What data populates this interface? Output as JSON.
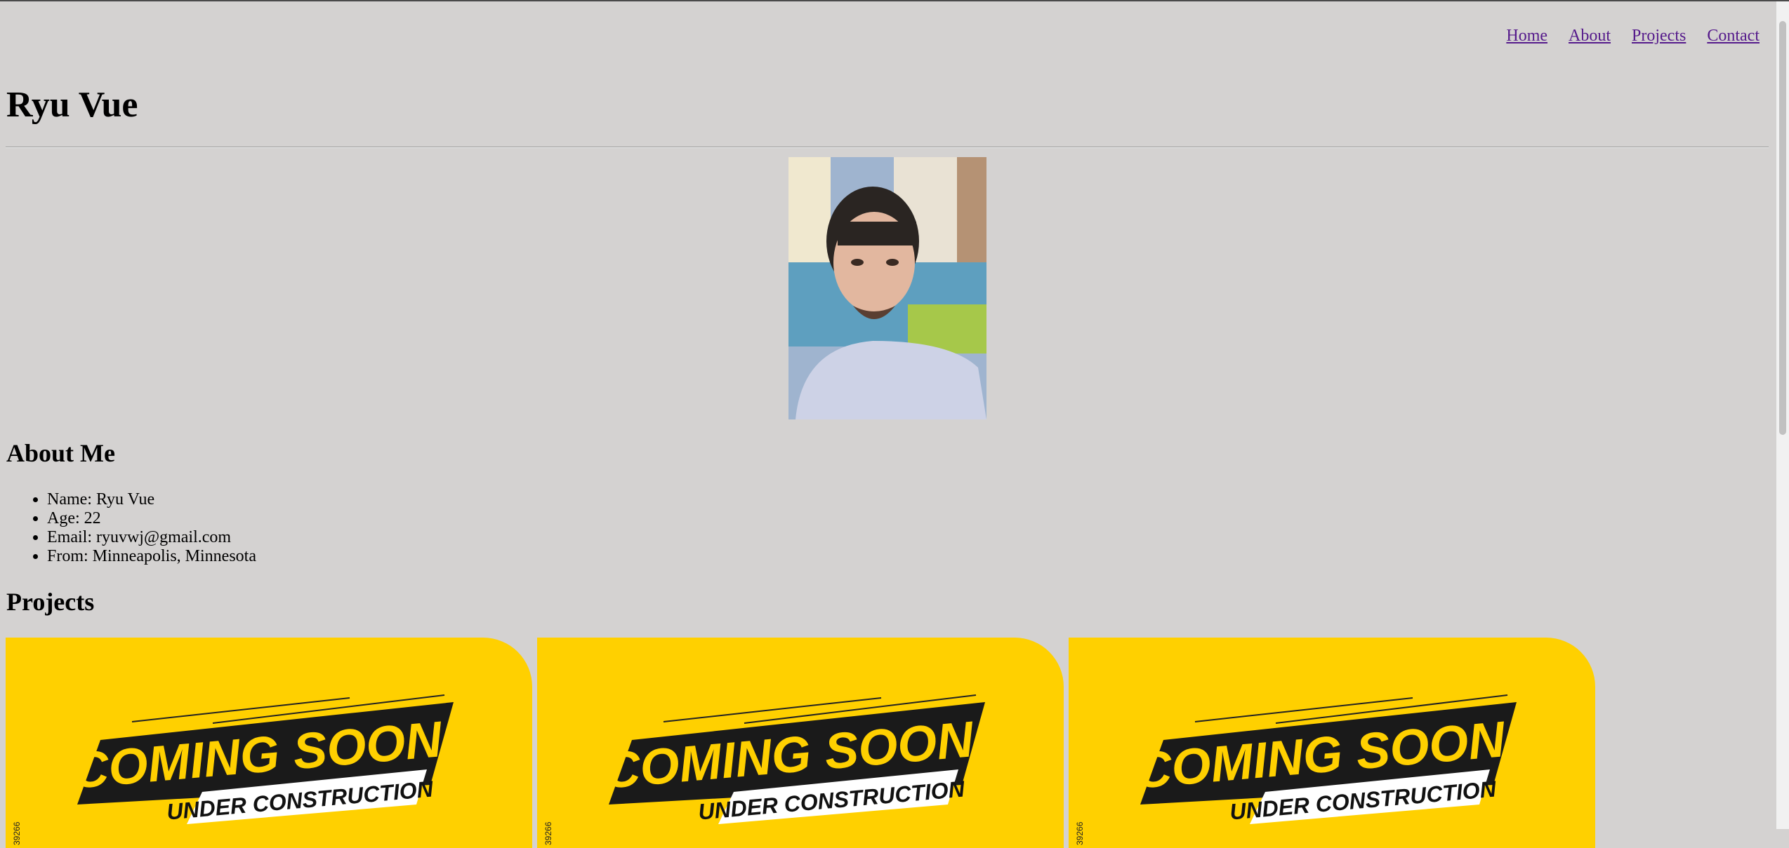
{
  "nav": {
    "items": [
      "Home",
      "About",
      "Projects",
      "Contact"
    ]
  },
  "header": {
    "title": "Ryu Vue"
  },
  "about": {
    "heading": "About Me",
    "items": [
      "Name: Ryu Vue",
      "Age: 22",
      "Email: ryuvwj@gmail.com",
      "From: Minneapolis, Minnesota"
    ]
  },
  "projects": {
    "heading": "Projects",
    "cards": [
      {
        "headline": "COMING SOON",
        "subline": "UNDER CONSTRUCTION",
        "code": "39266"
      },
      {
        "headline": "COMING SOON",
        "subline": "UNDER CONSTRUCTION",
        "code": "39266"
      },
      {
        "headline": "COMING SOON",
        "subline": "UNDER CONSTRUCTION",
        "code": "39266"
      }
    ]
  },
  "colors": {
    "background": "#d4d2d1",
    "link": "#551a8b",
    "card_yellow": "#ffd000"
  }
}
